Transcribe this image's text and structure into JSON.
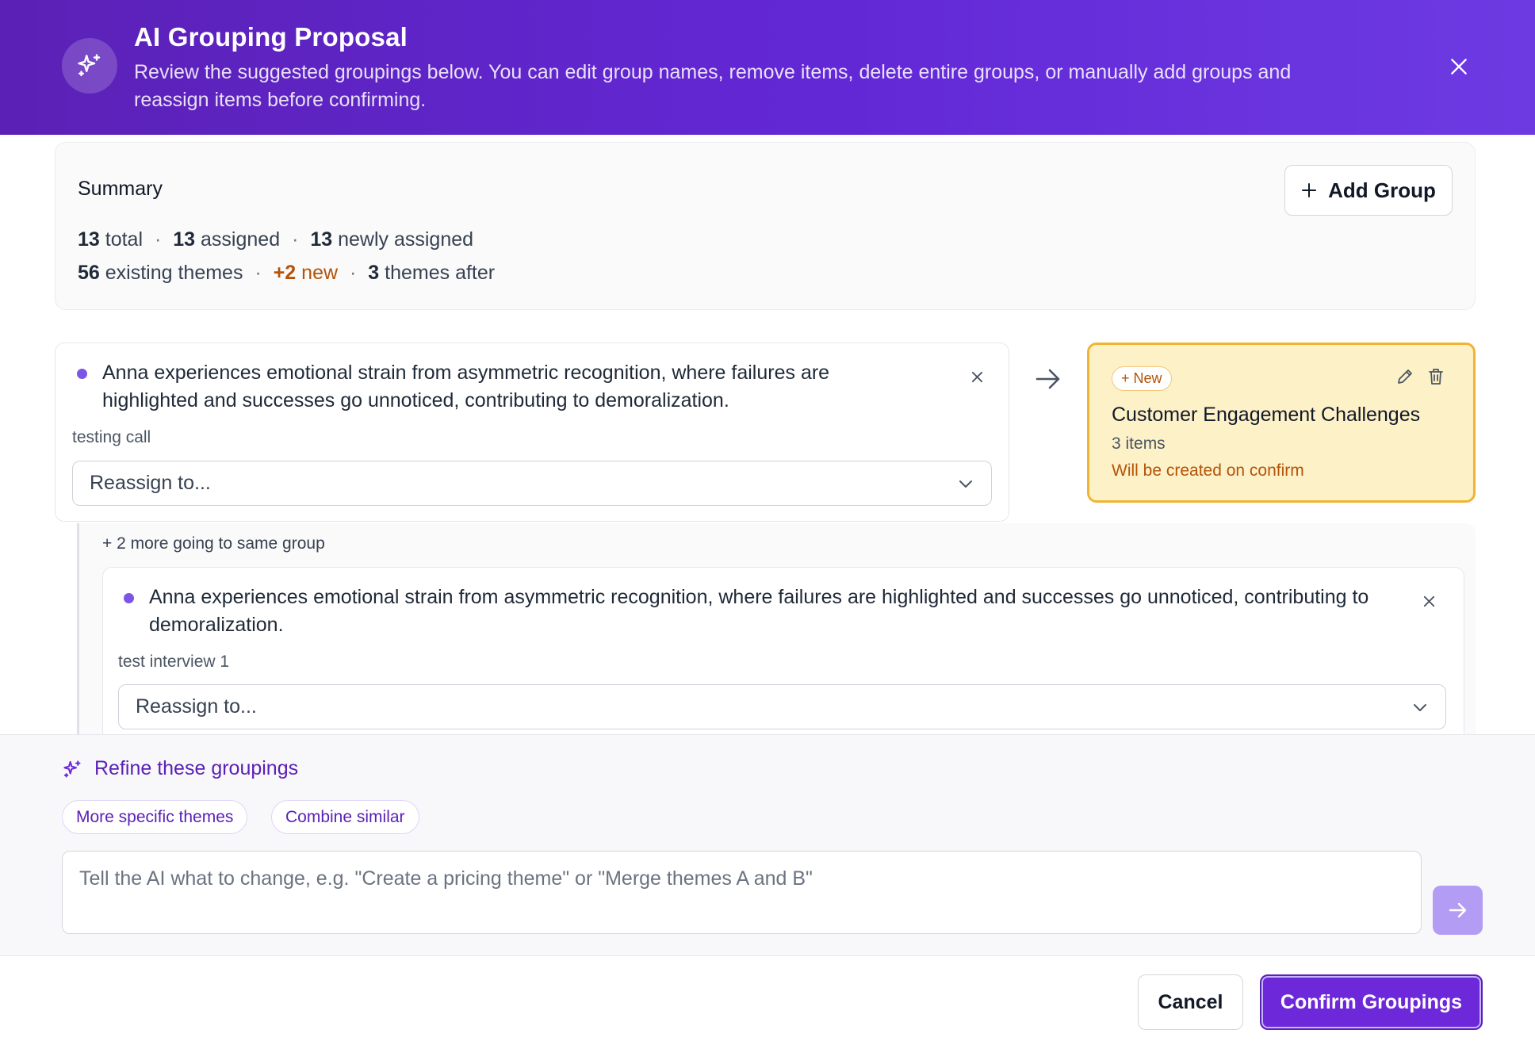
{
  "header": {
    "title": "AI Grouping Proposal",
    "description": "Review the suggested groupings below. You can edit group names, remove items, delete entire groups, or manually add groups and reassign items before confirming.",
    "icon": "sparkles-icon",
    "close_icon": "close-icon"
  },
  "summary": {
    "title": "Summary",
    "add_group_label": "Add Group",
    "line1": {
      "total_value": "13",
      "total_label": "total",
      "assigned_value": "13",
      "assigned_label": "assigned",
      "newly_value": "13",
      "newly_label": "newly assigned"
    },
    "line2": {
      "existing_value": "56",
      "existing_label": "existing themes",
      "new_value": "+2",
      "new_label": "new",
      "after_value": "3",
      "after_label": "themes after"
    },
    "separator": "·"
  },
  "proposal": {
    "item": {
      "text": "Anna experiences emotional strain from asymmetric recognition, where failures are highlighted and successes go unnoticed, contributing to demoralization.",
      "source": "testing call",
      "reassign_placeholder": "Reassign to..."
    },
    "group": {
      "badge": "+ New",
      "name": "Customer Engagement Challenges",
      "count": "3 items",
      "note": "Will be created on confirm"
    },
    "more": {
      "label": "+ 2 more going to same group",
      "items": [
        {
          "text": "Anna experiences emotional strain from asymmetric recognition, where failures are highlighted and successes go unnoticed, contributing to demoralization.",
          "source": "test interview 1",
          "reassign_placeholder": "Reassign to..."
        }
      ]
    }
  },
  "refine": {
    "title": "Refine these groupings",
    "chips": [
      "More specific themes",
      "Combine similar"
    ],
    "input_placeholder": "Tell the AI what to change, e.g. \"Create a pricing theme\" or \"Merge themes A and B\""
  },
  "footer": {
    "cancel_label": "Cancel",
    "confirm_label": "Confirm Groupings"
  },
  "colors": {
    "header_bg": "#5b21b6",
    "accent": "#6d28d9",
    "new_group_bg": "#fdf1c8",
    "new_group_border": "#f1b433",
    "new_text": "#b45309"
  }
}
